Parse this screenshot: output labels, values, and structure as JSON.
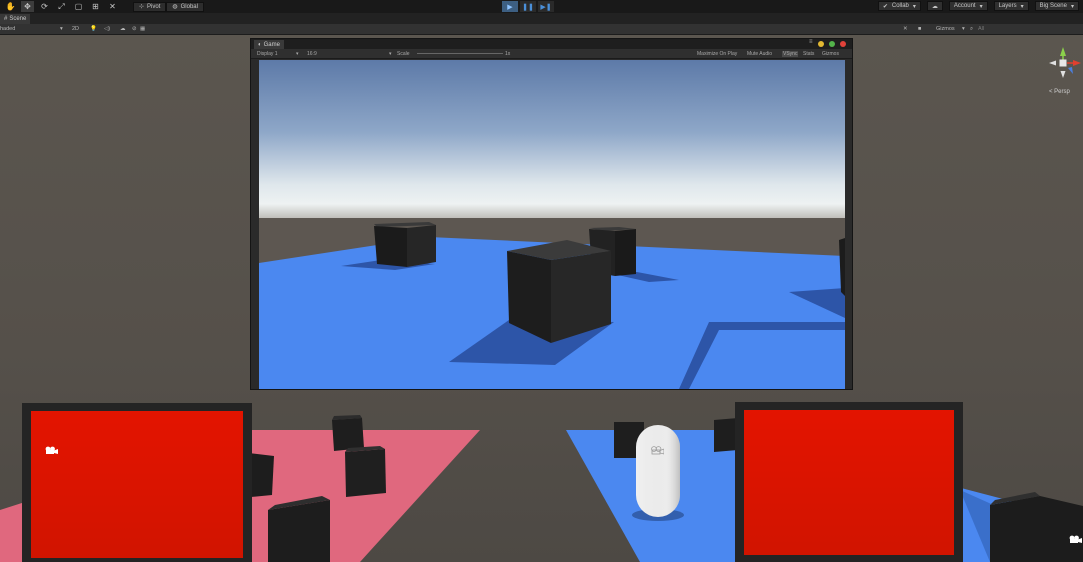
{
  "toolbar": {
    "tools": [
      {
        "name": "hand-tool",
        "glyph": "✋"
      },
      {
        "name": "move-tool",
        "glyph": "✥"
      },
      {
        "name": "rotate-tool",
        "glyph": "⟳"
      },
      {
        "name": "scale-tool",
        "glyph": "⤢"
      },
      {
        "name": "rect-tool",
        "glyph": "▢"
      },
      {
        "name": "transform-tool",
        "glyph": "⊞"
      },
      {
        "name": "custom-tool",
        "glyph": "✕"
      }
    ],
    "pivot_label": "Pivot",
    "global_label": "Global",
    "play": "▶",
    "pause": "❚❚",
    "step": "▶❚",
    "collab_label": "Collab",
    "account_label": "Account",
    "layers_label": "Layers",
    "layout_label": "Big Scene"
  },
  "scene_tab": {
    "label": "Scene"
  },
  "scene_bar": {
    "shading_mode": "haded",
    "mode_2d": "2D",
    "gizmos_label": "Gizmos",
    "search_placeholder": "All"
  },
  "game": {
    "tab_label": "Game",
    "display": "Display 1",
    "aspect": "16:9",
    "scale_label": "Scale",
    "scale_value": "1x",
    "maximize_label": "Maximize On Play",
    "mute_label": "Mute Audio",
    "vsync_label": "VSync",
    "stats_label": "Stats",
    "gizmos_label": "Gizmos"
  },
  "gizmo": {
    "persp_label": "< Persp"
  },
  "colors": {
    "ground_blue": "#4b88f0",
    "ground_pink": "#e0687e",
    "panel_red": "#e31400",
    "cube_dark": "#1e1e1e"
  }
}
